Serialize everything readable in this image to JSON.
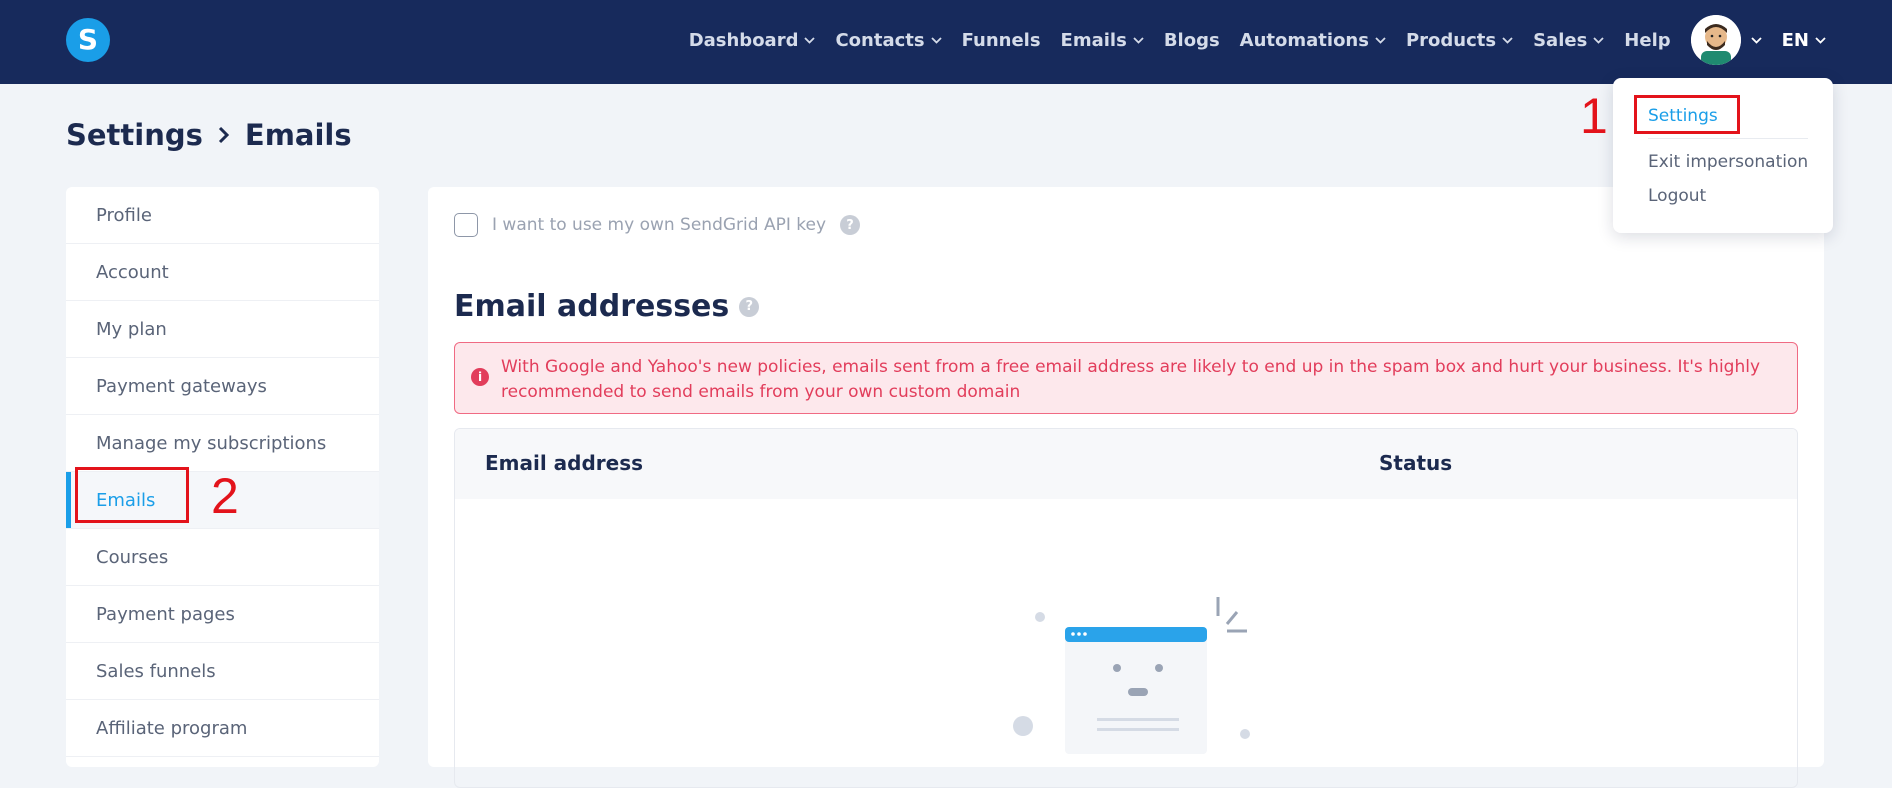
{
  "brand": {
    "logo_letter": "S",
    "color": "#1a9ee8"
  },
  "nav": {
    "items": [
      {
        "label": "Dashboard",
        "dropdown": true
      },
      {
        "label": "Contacts",
        "dropdown": true
      },
      {
        "label": "Funnels",
        "dropdown": false
      },
      {
        "label": "Emails",
        "dropdown": true
      },
      {
        "label": "Blogs",
        "dropdown": false
      },
      {
        "label": "Automations",
        "dropdown": true
      },
      {
        "label": "Products",
        "dropdown": true
      },
      {
        "label": "Sales",
        "dropdown": true
      },
      {
        "label": "Help",
        "dropdown": false
      }
    ],
    "language": "EN"
  },
  "breadcrumb": {
    "root": "Settings",
    "current": "Emails"
  },
  "sidebar": {
    "items": [
      {
        "label": "Profile"
      },
      {
        "label": "Account"
      },
      {
        "label": "My plan"
      },
      {
        "label": "Payment gateways"
      },
      {
        "label": "Manage my subscriptions"
      },
      {
        "label": "Emails",
        "active": true
      },
      {
        "label": "Courses"
      },
      {
        "label": "Payment pages"
      },
      {
        "label": "Sales funnels"
      },
      {
        "label": "Affiliate program"
      }
    ]
  },
  "main": {
    "sendgrid_label": "I want to use my own SendGrid API key",
    "help_glyph": "?",
    "section_title": "Email addresses",
    "alert_text": "With Google and Yahoo's new policies, emails sent from a free email address are likely to end up in the spam box and hurt your business. It's highly recommended to send emails from your own custom domain",
    "alert_icon": "i",
    "table": {
      "headers": [
        "Email address",
        "Status"
      ]
    }
  },
  "user_menu": {
    "items": [
      {
        "label": "Settings",
        "highlight": true
      },
      {
        "label": "Exit impersonation"
      },
      {
        "label": "Logout"
      }
    ]
  },
  "annotations": {
    "num1": "1",
    "num2": "2"
  }
}
